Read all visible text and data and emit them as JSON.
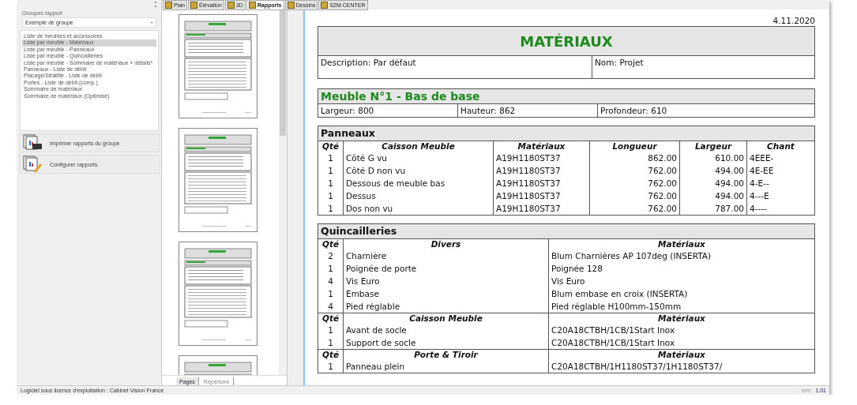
{
  "tabs": [
    {
      "label": "Plan",
      "selected": false
    },
    {
      "label": "Élévation",
      "selected": false
    },
    {
      "label": "3D",
      "selected": false
    },
    {
      "label": "Rapports",
      "selected": true
    },
    {
      "label": "Dessins",
      "selected": false
    },
    {
      "label": "S2M CENTER",
      "selected": false
    }
  ],
  "sidebar": {
    "group_label": "Groupes rapport",
    "group_select": "Exemple de groupe",
    "items": [
      {
        "label": "Liste de meubles et accessoires",
        "selected": false
      },
      {
        "label": "Liste par meuble - Matériaux",
        "selected": true
      },
      {
        "label": "Liste par meuble - Panneaux",
        "selected": false
      },
      {
        "label": "Liste par meuble - Quincailleries",
        "selected": false
      },
      {
        "label": "Liste par meuble - Sommaire de matériaux + détails*",
        "selected": false
      },
      {
        "label": "Panneaux - Liste de débit",
        "selected": false
      },
      {
        "label": "Placage/Stratifié - Liste de débit",
        "selected": false
      },
      {
        "label": "Portes - Liste de débit (comp.)",
        "selected": false
      },
      {
        "label": "Sommaire de matériaux",
        "selected": false
      },
      {
        "label": "Sommaire de matériaux (Optimisé)",
        "selected": false
      }
    ],
    "actions": [
      {
        "kind": "print",
        "label": "Imprimer rapports du groupe"
      },
      {
        "kind": "configure",
        "label": "Configurer rapports"
      }
    ]
  },
  "preview_tabs": [
    {
      "label": "Pages",
      "selected": true
    },
    {
      "label": "Répertoire",
      "selected": false
    }
  ],
  "report": {
    "date": "4.11.2020",
    "title": "MATÉRIAUX",
    "header_fields": [
      {
        "label": "Description:",
        "value": "Par défaut"
      },
      {
        "label": "Nom:",
        "value": "Projet"
      }
    ],
    "cabinet": {
      "title": "Meuble N°1 - Bas de base",
      "fields": [
        {
          "label": "Largeur:",
          "value": "800"
        },
        {
          "label": "Hauteur:",
          "value": "862"
        },
        {
          "label": "Profondeur:",
          "value": "610"
        }
      ]
    },
    "panels": {
      "title": "Panneaux",
      "columns": [
        "Qté",
        "Caisson Meuble",
        "Matériaux",
        "Longueur",
        "Largeur",
        "Chant"
      ],
      "rows": [
        [
          "1",
          "Côté G vu",
          "A19H1180ST37",
          "862.00",
          "610.00",
          "4EEE-"
        ],
        [
          "1",
          "Côté D non vu",
          "A19H1180ST37",
          "762.00",
          "494.00",
          "4E-EE"
        ],
        [
          "1",
          "Dessous de meuble bas",
          "A19H1180ST37",
          "762.00",
          "494.00",
          "4-E--"
        ],
        [
          "1",
          "Dessus",
          "A19H1180ST37",
          "762.00",
          "494.00",
          "4---E"
        ],
        [
          "1",
          "Dos non vu",
          "A19H1180ST37",
          "762.00",
          "787.00",
          "4----"
        ]
      ]
    },
    "hardware": {
      "title": "Quincailleries",
      "groups": [
        {
          "columns": [
            "Qté",
            "Divers",
            "Matériaux"
          ],
          "rows": [
            [
              "2",
              "Charnière",
              "Blum Charnières AP 107deg (INSERTA)"
            ],
            [
              "1",
              "Poignée de porte",
              "Poignée 128"
            ],
            [
              "4",
              "Vis Euro",
              "Vis Euro"
            ],
            [
              "1",
              "Embase",
              "Blum embase en croix (INSERTA)"
            ],
            [
              "4",
              "Pied réglable",
              "Pied réglable H100mm-150mm"
            ]
          ]
        },
        {
          "columns": [
            "Qté",
            "Caisson Meuble",
            "Matériaux"
          ],
          "rows": [
            [
              "1",
              "Avant de socle",
              "C20A18CTBH/1CB/1Start Inox"
            ],
            [
              "1",
              "Support de socle",
              "C20A18CTBH/1CB/1Start Inox"
            ]
          ]
        },
        {
          "columns": [
            "Qté",
            "Porte & Tiroir",
            "Matériaux"
          ],
          "rows": [
            [
              "1",
              "Panneau plein",
              "C20A18CTBH/1H1180ST37/1H1180ST37/"
            ]
          ]
        }
      ]
    }
  },
  "status_bar": {
    "license": "Logiciel sous licence d'exploitation : Cabinet Vision France",
    "unit": "mm",
    "zoom": "1.01"
  }
}
